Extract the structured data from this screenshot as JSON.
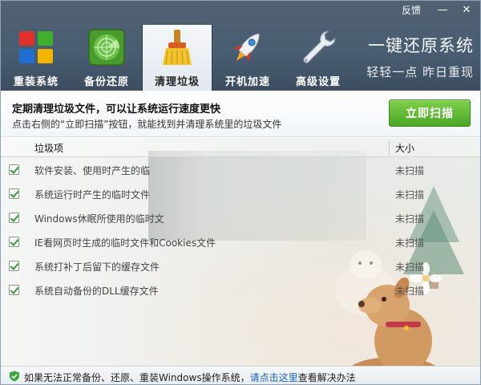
{
  "window": {
    "feedback_label": "反馈",
    "minimize_label": "—",
    "close_label": "✕"
  },
  "tabs": [
    {
      "label": "重装系统",
      "icon": "windows-logo-icon",
      "active": false
    },
    {
      "label": "备份还原",
      "icon": "radar-icon",
      "active": false
    },
    {
      "label": "清理垃圾",
      "icon": "broom-icon",
      "active": true
    },
    {
      "label": "开机加速",
      "icon": "rocket-icon",
      "active": false
    },
    {
      "label": "高级设置",
      "icon": "wrench-icon",
      "active": false
    }
  ],
  "slogan": {
    "main": "一键还原系统",
    "sub": "轻轻一点  昨日重现"
  },
  "info": {
    "title": "定期清理垃圾文件，可以让系统运行速度更快",
    "subtitle": "点击右侧的“立即扫描”按钮，就能找到并清理系统里的垃圾文件",
    "scan_button": "立即扫描"
  },
  "list": {
    "columns": {
      "name": "垃圾项",
      "size": "大小"
    },
    "rows": [
      {
        "name": "软件安装、使用时产生的临",
        "size": "未扫描",
        "checked": true
      },
      {
        "name": "系统运行时产生的临时文件",
        "size": "未扫描",
        "checked": true
      },
      {
        "name": "Windows休眠所使用的临时文",
        "size": "未扫描",
        "checked": true
      },
      {
        "name": "IE看网页时生成的临时文件和Cookies文件",
        "size": "未扫描",
        "checked": true
      },
      {
        "name": "系统打补丁后留下的缓存文件",
        "size": "未扫描",
        "checked": true
      },
      {
        "name": "系统自动备份的DLL缓存文件",
        "size": "未扫描",
        "checked": true
      }
    ]
  },
  "footer": {
    "text_before": "如果无法正常备份、还原、重装Windows操作系统，",
    "link": "请点击这里",
    "text_after": "查看解决办法"
  },
  "colors": {
    "header_bg": "#445669",
    "scan_button": "#5cb82f",
    "link": "#1a63c4",
    "check": "#2f9a2f"
  }
}
